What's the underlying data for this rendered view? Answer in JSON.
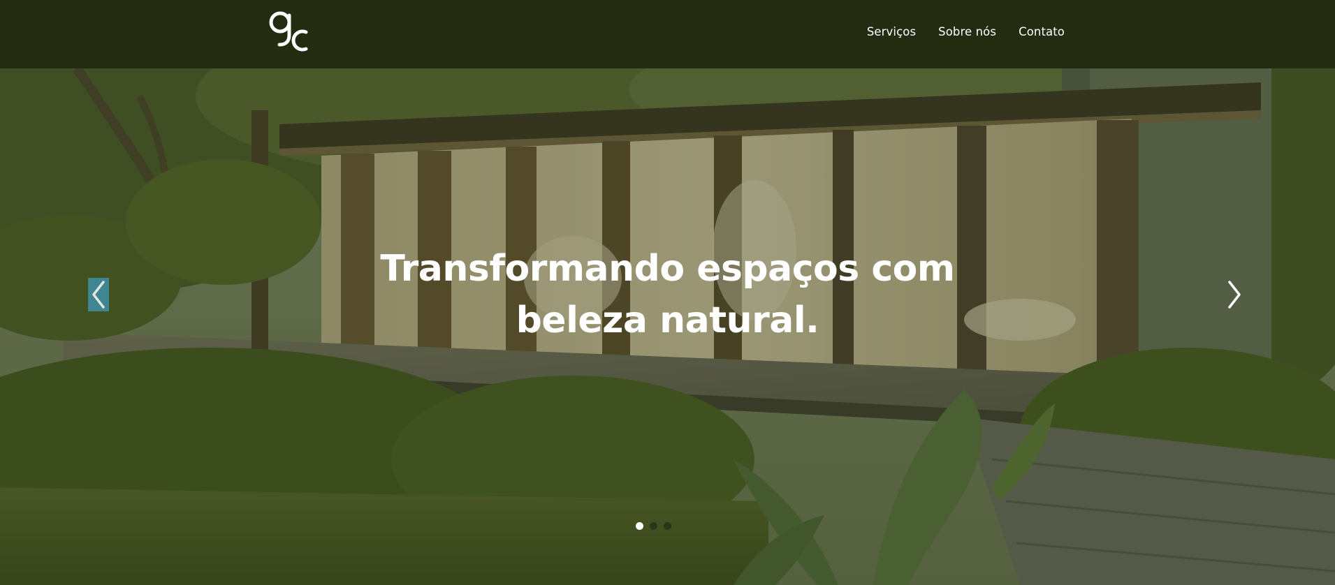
{
  "brand": {
    "logo_text": "gc",
    "logo_icon": "gc-monogram-logo"
  },
  "nav": {
    "items": [
      {
        "label": "Serviços"
      },
      {
        "label": "Sobre nós"
      },
      {
        "label": "Contato"
      }
    ]
  },
  "hero": {
    "headline_line1": "Transformando espaços com",
    "headline_line2": "beleza natural.",
    "prev_icon": "chevron-left-icon",
    "next_icon": "chevron-right-icon",
    "slides_total": 3,
    "active_slide": 1
  },
  "colors": {
    "header_bg": "#232b11",
    "overlay": "#2c3816",
    "text": "#ffffff",
    "prev_arrow_bg": "#3f8fa6"
  }
}
